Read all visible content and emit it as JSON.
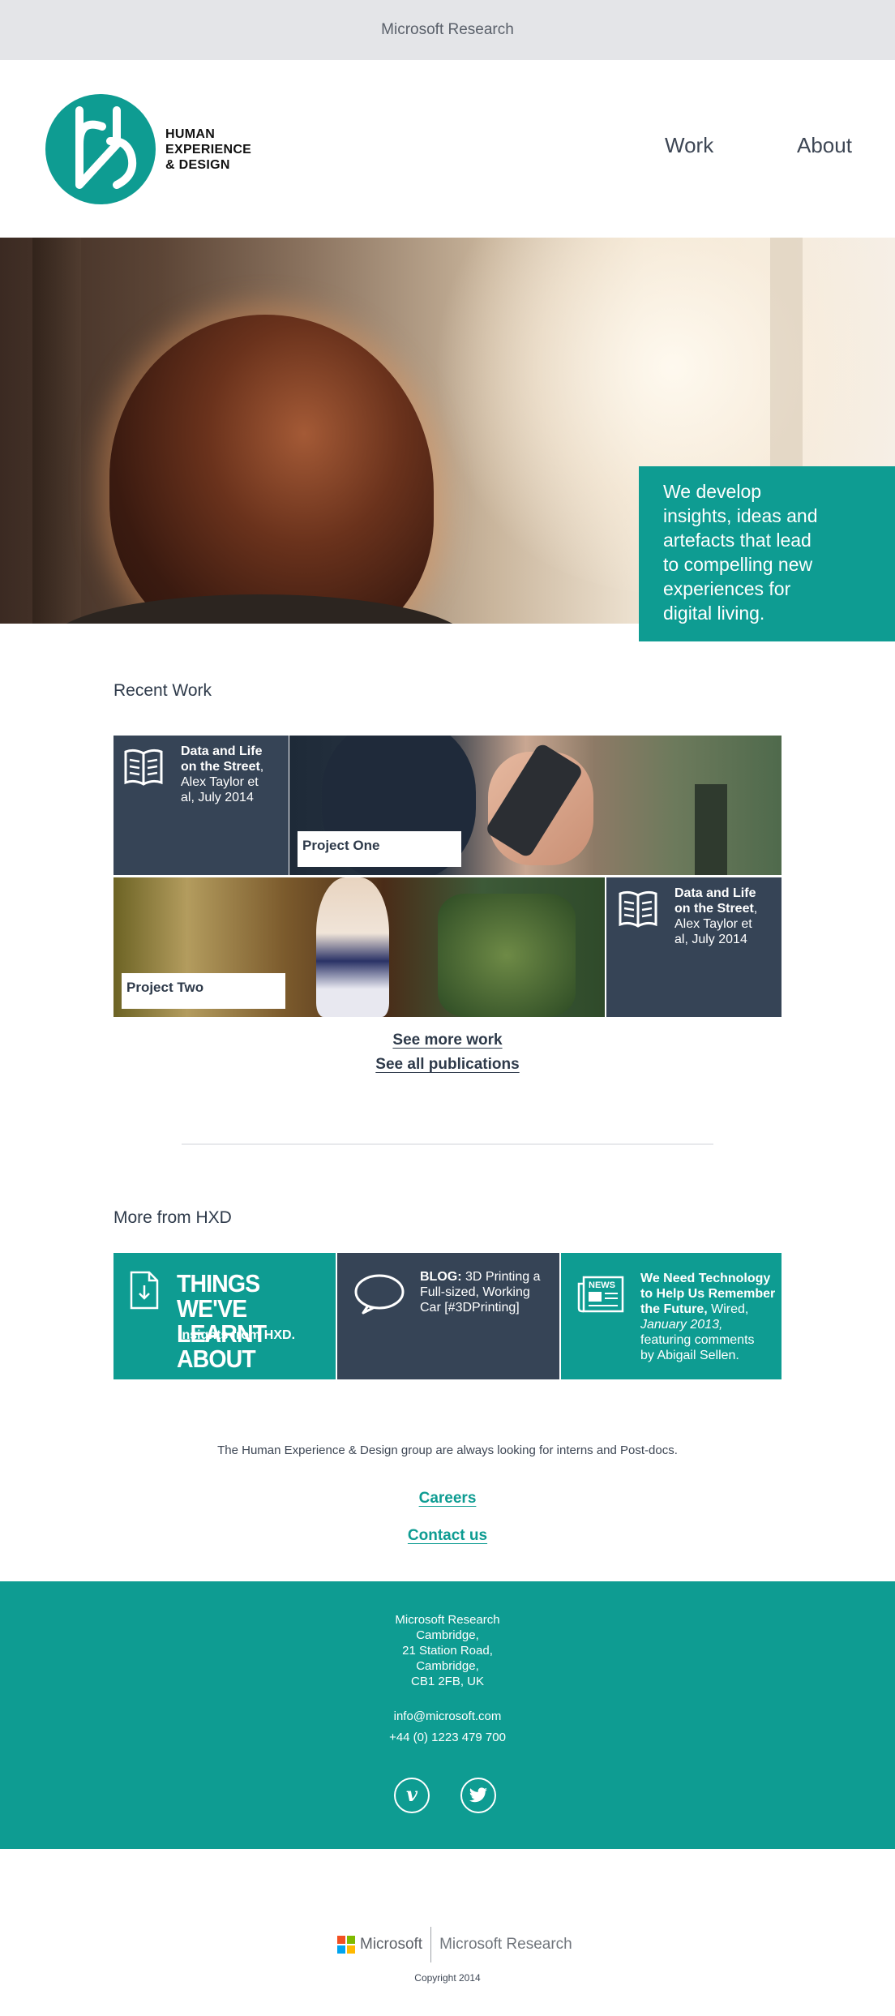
{
  "topbar": {
    "title": "Microsoft Research"
  },
  "header": {
    "logo_lines": [
      "HUMAN",
      "EXPERIENCE",
      "& DESIGN"
    ],
    "nav": [
      {
        "label": "Work"
      },
      {
        "label": "About"
      }
    ]
  },
  "hero": {
    "caption_lines": [
      "We develop",
      "insights, ideas and",
      "artefacts that lead",
      "to compelling new",
      "experiences for",
      "digital living."
    ]
  },
  "recent_work": {
    "title": "Recent Work",
    "pub1": {
      "title_lines": [
        "Data and Life",
        "on the Street"
      ],
      "comma": ",",
      "detail_lines": [
        "Alex Taylor et",
        "al, July 2014"
      ]
    },
    "project_one": "Project One",
    "project_two": "Project Two",
    "pub2": {
      "title_lines": [
        "Data and Life",
        "on the Street"
      ],
      "comma": ",",
      "detail_lines": [
        "Alex Taylor et",
        "al, July 2014"
      ]
    },
    "see_more": "See more work",
    "see_pubs": "See all publications"
  },
  "more": {
    "title": "More from HXD",
    "card1": {
      "head_lines": [
        "THINGS WE'VE",
        "LEARNT ABOUT"
      ],
      "sub": "Insights from HXD."
    },
    "card2": {
      "label": "BLOG:",
      "text_lines": [
        "3D Printing a",
        "Full-sized, Working",
        "Car [#3DPrinting]"
      ]
    },
    "card3": {
      "title_lines": [
        "We Need Technology",
        "to Help Us Remember",
        "the Future,"
      ],
      "source": "Wired,",
      "date": "January 2013,",
      "rest_lines": [
        "featuring comments",
        "by Abigail Sellen."
      ],
      "badge": "NEWS"
    }
  },
  "notice": "The Human Experience & Design group are always looking for interns and Post-docs.",
  "links": {
    "careers": "Careers",
    "contact": "Contact us"
  },
  "footer": {
    "address_lines": [
      "Microsoft Research",
      "Cambridge,",
      "21 Station Road,",
      "Cambridge,",
      "CB1 2FB, UK"
    ],
    "email": "info@microsoft.com",
    "phone": "+44 (0) 1223 479 700",
    "social": [
      {
        "icon": "vimeo-icon",
        "glyph": "v"
      },
      {
        "icon": "twitter-icon"
      }
    ]
  },
  "bottom": {
    "microsoft": "Microsoft",
    "research": "Microsoft Research",
    "copyright": "Copyright 2014"
  },
  "colors": {
    "teal": "#0e9c92",
    "navy": "#364456",
    "topbar": "#e4e5e8"
  }
}
